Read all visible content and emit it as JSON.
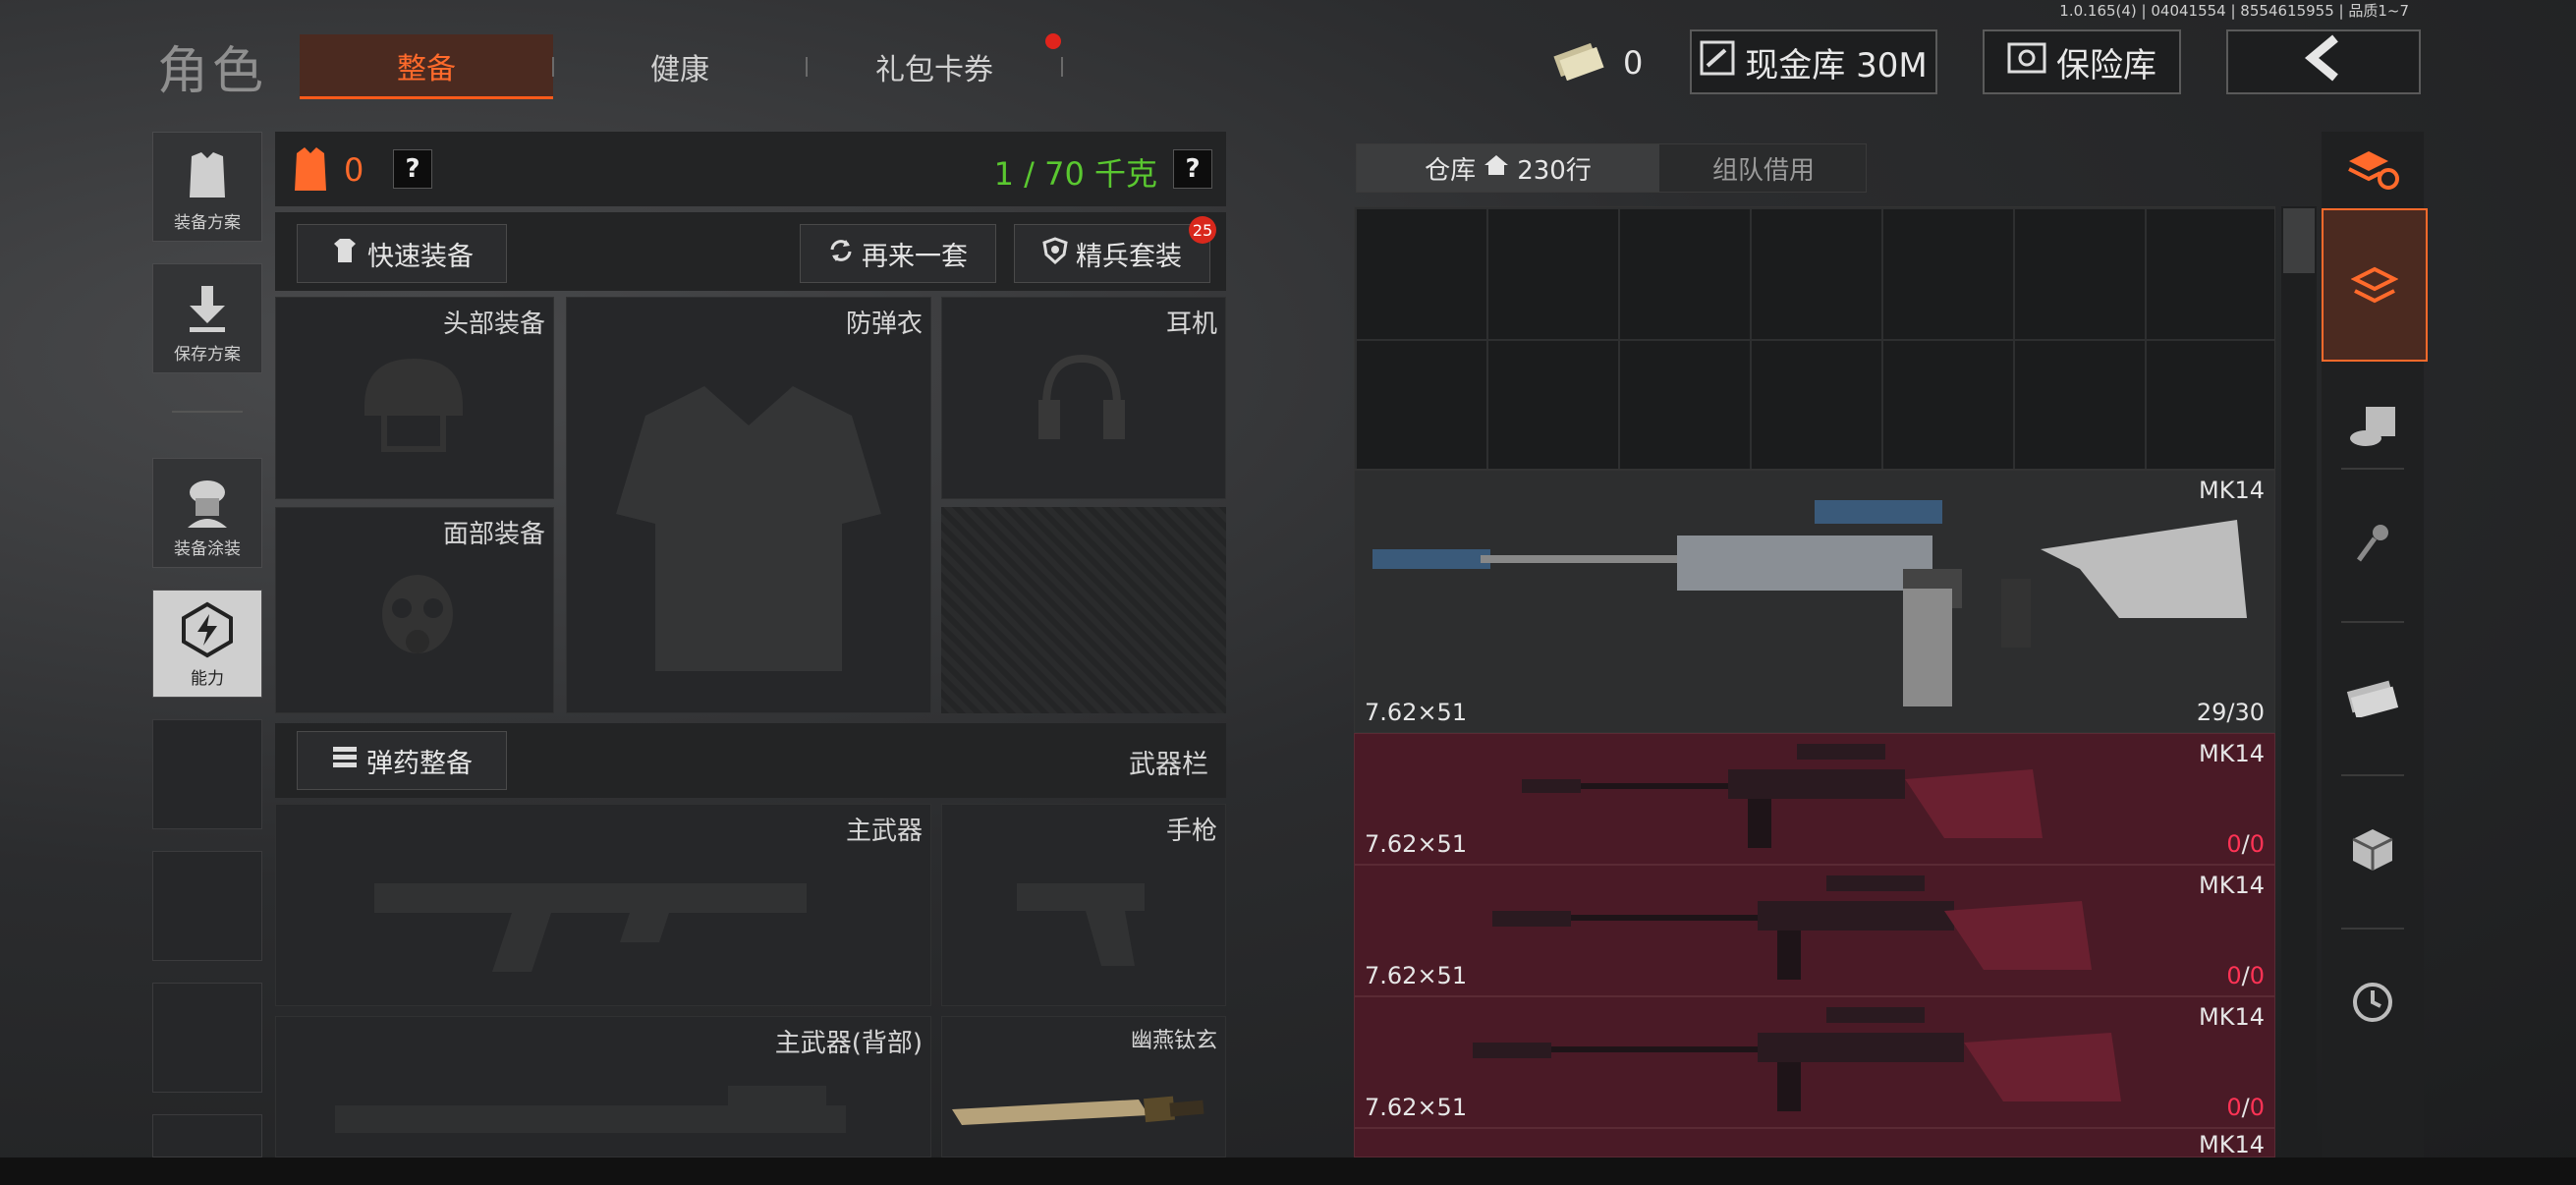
{
  "version": "1.0.165(4) | 04041554 | 8554615955 | 品质1~7",
  "header": {
    "title": "角色",
    "tabs": [
      {
        "label": "整备",
        "active": true
      },
      {
        "label": "健康",
        "active": false
      },
      {
        "label": "礼包卡券",
        "active": false,
        "badge": true
      }
    ],
    "currency_count": "0",
    "cash_label": "现金库 30M",
    "vault_label": "保险库"
  },
  "sidebar": {
    "items": [
      {
        "label": "装备方案",
        "icon": "vest-icon"
      },
      {
        "label": "保存方案",
        "icon": "download-icon"
      },
      {
        "label": "装备涂装",
        "icon": "soldier-icon"
      },
      {
        "label": "能力",
        "icon": "power-icon",
        "active": true
      }
    ]
  },
  "loadout": {
    "armor_count": "0",
    "weight": "1 / 70 千克",
    "help": "?",
    "quick_equip": "快速装备",
    "redo": "再来一套",
    "elite_set": "精兵套装",
    "elite_badge": "25",
    "slots": {
      "head": "头部装备",
      "vest": "防弹衣",
      "headset": "耳机",
      "face": "面部装备",
      "primary": "主武器",
      "pistol": "手枪",
      "primary_back": "主武器(背部)",
      "melee": "幽燕钛玄"
    },
    "ammo_equip": "弹药整备",
    "weapon_bar": "武器栏"
  },
  "warehouse": {
    "tab_storage": "仓库",
    "rows": "230行",
    "tab_team": "组队借用",
    "items": [
      {
        "name": "MK14",
        "caliber": "7.62×51",
        "count_a": "29",
        "count_b": "30",
        "state": "normal"
      },
      {
        "name": "MK14",
        "caliber": "7.62×51",
        "count_a": "0",
        "count_b": "0",
        "state": "unavailable"
      },
      {
        "name": "MK14",
        "caliber": "7.62×51",
        "count_a": "0",
        "count_b": "0",
        "state": "unavailable"
      },
      {
        "name": "MK14",
        "caliber": "7.62×51",
        "count_a": "0",
        "count_b": "0",
        "state": "unavailable"
      },
      {
        "name": "MK14"
      }
    ]
  },
  "colors": {
    "accent": "#ff6a2b",
    "weight_ok": "#5ac830",
    "unavailable_bg": "#4a1a26",
    "warning": "#ff3355"
  }
}
